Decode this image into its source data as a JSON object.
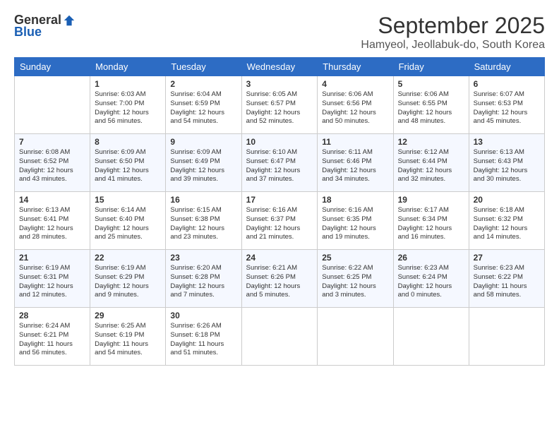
{
  "logo": {
    "general": "General",
    "blue": "Blue"
  },
  "header": {
    "month": "September 2025",
    "location": "Hamyeol, Jeollabuk-do, South Korea"
  },
  "weekdays": [
    "Sunday",
    "Monday",
    "Tuesday",
    "Wednesday",
    "Thursday",
    "Friday",
    "Saturday"
  ],
  "weeks": [
    [
      {
        "day": "",
        "info": ""
      },
      {
        "day": "1",
        "info": "Sunrise: 6:03 AM\nSunset: 7:00 PM\nDaylight: 12 hours\nand 56 minutes."
      },
      {
        "day": "2",
        "info": "Sunrise: 6:04 AM\nSunset: 6:59 PM\nDaylight: 12 hours\nand 54 minutes."
      },
      {
        "day": "3",
        "info": "Sunrise: 6:05 AM\nSunset: 6:57 PM\nDaylight: 12 hours\nand 52 minutes."
      },
      {
        "day": "4",
        "info": "Sunrise: 6:06 AM\nSunset: 6:56 PM\nDaylight: 12 hours\nand 50 minutes."
      },
      {
        "day": "5",
        "info": "Sunrise: 6:06 AM\nSunset: 6:55 PM\nDaylight: 12 hours\nand 48 minutes."
      },
      {
        "day": "6",
        "info": "Sunrise: 6:07 AM\nSunset: 6:53 PM\nDaylight: 12 hours\nand 45 minutes."
      }
    ],
    [
      {
        "day": "7",
        "info": "Sunrise: 6:08 AM\nSunset: 6:52 PM\nDaylight: 12 hours\nand 43 minutes."
      },
      {
        "day": "8",
        "info": "Sunrise: 6:09 AM\nSunset: 6:50 PM\nDaylight: 12 hours\nand 41 minutes."
      },
      {
        "day": "9",
        "info": "Sunrise: 6:09 AM\nSunset: 6:49 PM\nDaylight: 12 hours\nand 39 minutes."
      },
      {
        "day": "10",
        "info": "Sunrise: 6:10 AM\nSunset: 6:47 PM\nDaylight: 12 hours\nand 37 minutes."
      },
      {
        "day": "11",
        "info": "Sunrise: 6:11 AM\nSunset: 6:46 PM\nDaylight: 12 hours\nand 34 minutes."
      },
      {
        "day": "12",
        "info": "Sunrise: 6:12 AM\nSunset: 6:44 PM\nDaylight: 12 hours\nand 32 minutes."
      },
      {
        "day": "13",
        "info": "Sunrise: 6:13 AM\nSunset: 6:43 PM\nDaylight: 12 hours\nand 30 minutes."
      }
    ],
    [
      {
        "day": "14",
        "info": "Sunrise: 6:13 AM\nSunset: 6:41 PM\nDaylight: 12 hours\nand 28 minutes."
      },
      {
        "day": "15",
        "info": "Sunrise: 6:14 AM\nSunset: 6:40 PM\nDaylight: 12 hours\nand 25 minutes."
      },
      {
        "day": "16",
        "info": "Sunrise: 6:15 AM\nSunset: 6:38 PM\nDaylight: 12 hours\nand 23 minutes."
      },
      {
        "day": "17",
        "info": "Sunrise: 6:16 AM\nSunset: 6:37 PM\nDaylight: 12 hours\nand 21 minutes."
      },
      {
        "day": "18",
        "info": "Sunrise: 6:16 AM\nSunset: 6:35 PM\nDaylight: 12 hours\nand 19 minutes."
      },
      {
        "day": "19",
        "info": "Sunrise: 6:17 AM\nSunset: 6:34 PM\nDaylight: 12 hours\nand 16 minutes."
      },
      {
        "day": "20",
        "info": "Sunrise: 6:18 AM\nSunset: 6:32 PM\nDaylight: 12 hours\nand 14 minutes."
      }
    ],
    [
      {
        "day": "21",
        "info": "Sunrise: 6:19 AM\nSunset: 6:31 PM\nDaylight: 12 hours\nand 12 minutes."
      },
      {
        "day": "22",
        "info": "Sunrise: 6:19 AM\nSunset: 6:29 PM\nDaylight: 12 hours\nand 9 minutes."
      },
      {
        "day": "23",
        "info": "Sunrise: 6:20 AM\nSunset: 6:28 PM\nDaylight: 12 hours\nand 7 minutes."
      },
      {
        "day": "24",
        "info": "Sunrise: 6:21 AM\nSunset: 6:26 PM\nDaylight: 12 hours\nand 5 minutes."
      },
      {
        "day": "25",
        "info": "Sunrise: 6:22 AM\nSunset: 6:25 PM\nDaylight: 12 hours\nand 3 minutes."
      },
      {
        "day": "26",
        "info": "Sunrise: 6:23 AM\nSunset: 6:24 PM\nDaylight: 12 hours\nand 0 minutes."
      },
      {
        "day": "27",
        "info": "Sunrise: 6:23 AM\nSunset: 6:22 PM\nDaylight: 11 hours\nand 58 minutes."
      }
    ],
    [
      {
        "day": "28",
        "info": "Sunrise: 6:24 AM\nSunset: 6:21 PM\nDaylight: 11 hours\nand 56 minutes."
      },
      {
        "day": "29",
        "info": "Sunrise: 6:25 AM\nSunset: 6:19 PM\nDaylight: 11 hours\nand 54 minutes."
      },
      {
        "day": "30",
        "info": "Sunrise: 6:26 AM\nSunset: 6:18 PM\nDaylight: 11 hours\nand 51 minutes."
      },
      {
        "day": "",
        "info": ""
      },
      {
        "day": "",
        "info": ""
      },
      {
        "day": "",
        "info": ""
      },
      {
        "day": "",
        "info": ""
      }
    ]
  ]
}
